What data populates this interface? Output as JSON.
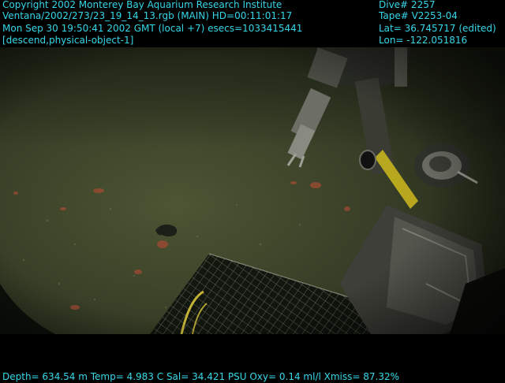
{
  "overlay": {
    "left_lines": [
      "Copyright 2002 Monterey Bay Aquarium Research Institute",
      "Ventana/2002/273/23_19_14_13.rgb (MAIN)  HD=00:11:01:17",
      "Mon Sep 30 19:50:41 2002 GMT (local +7)  esecs=1033415441",
      "[descend,physical-object-1]"
    ],
    "right_lines": [
      "Dive# 2257",
      "Tape# V2253-04",
      "Lat= 36.745717 (edited)",
      "Lon= -122.051816"
    ],
    "footer": "Depth= 634.54 m  Temp= 4.983 C  Sal= 34.421 PSU  Oxy= 0.14 ml/l  Xmiss= 87.32%",
    "text_color": "#35d7e8"
  }
}
